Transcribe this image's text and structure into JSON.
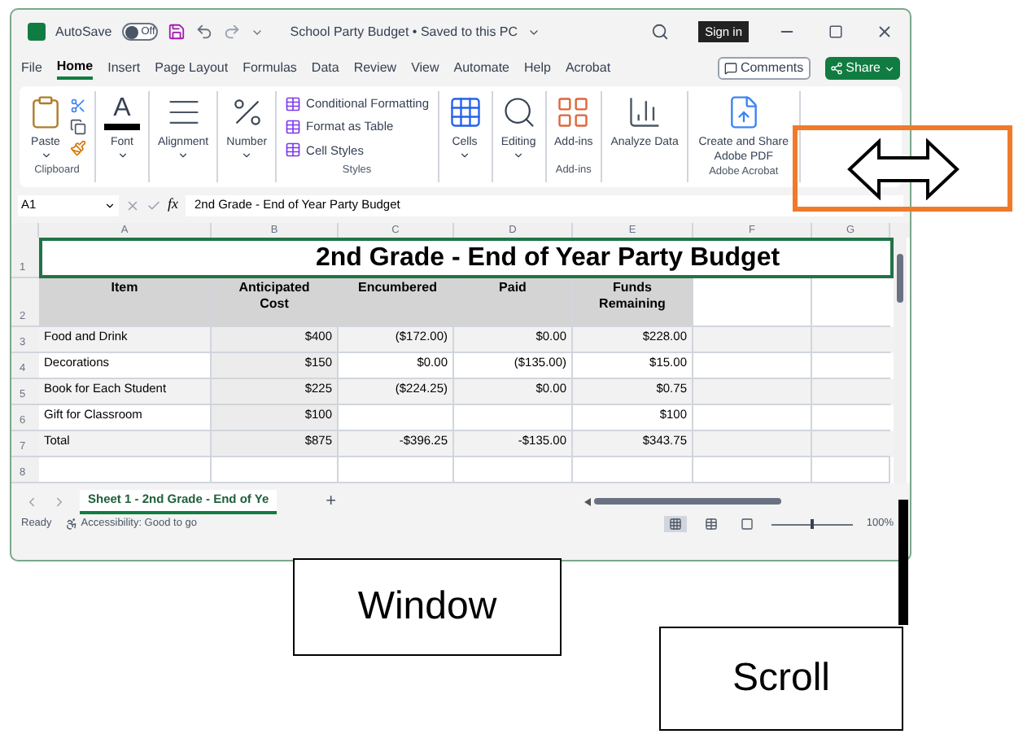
{
  "window": {
    "autosave": {
      "label": "AutoSave",
      "toggle": "Off",
      "on": false
    },
    "title": "School Party Budget • Saved to this PC",
    "sign_in": "Sign in"
  },
  "menu_tabs": [
    {
      "label": "File",
      "selected": false
    },
    {
      "label": "Home",
      "selected": true
    },
    {
      "label": "Insert",
      "selected": false
    },
    {
      "label": "Page Layout",
      "selected": false
    },
    {
      "label": "Formulas",
      "selected": false
    },
    {
      "label": "Data",
      "selected": false
    },
    {
      "label": "Review",
      "selected": false
    },
    {
      "label": "View",
      "selected": false
    },
    {
      "label": "Automate",
      "selected": false
    },
    {
      "label": "Help",
      "selected": false
    },
    {
      "label": "Acrobat",
      "selected": false
    }
  ],
  "comments": "Comments",
  "share": "Share",
  "ribbon": [
    {
      "label": "Clipboard",
      "buttons": [
        {
          "kind": "paste",
          "label": "Paste"
        }
      ]
    },
    {
      "buttons": [
        {
          "kind": "font",
          "label": "Font",
          "glyph": "A"
        }
      ]
    },
    {
      "buttons": [
        {
          "kind": "align",
          "label": "Alignment"
        }
      ]
    },
    {
      "buttons": [
        {
          "kind": "number",
          "label": "Number"
        }
      ]
    },
    {
      "label": "Styles",
      "buttons": [
        {
          "kind": "style",
          "label": "Conditional Formatting"
        },
        {
          "kind": "style",
          "label": "Format as Table"
        },
        {
          "kind": "style",
          "label": "Cell Styles"
        }
      ]
    },
    {
      "buttons": [
        {
          "kind": "cells",
          "label": "Cells"
        }
      ]
    },
    {
      "buttons": [
        {
          "kind": "editing",
          "label": "Editing"
        }
      ]
    },
    {
      "label": "Add-ins",
      "buttons": [
        {
          "kind": "addins",
          "label": "Add-ins"
        }
      ]
    },
    {
      "buttons": [
        {
          "kind": "analyze",
          "label": "Analyze Data"
        }
      ]
    },
    {
      "label": "Adobe Acrobat",
      "buttons": [
        {
          "kind": "pdf",
          "label": "Create and Share Adobe PDF"
        }
      ]
    }
  ],
  "formula_bar": {
    "name_box": "A1",
    "fx": "fx",
    "formula": "2nd Grade - End of Year Party Budget"
  },
  "columns": [
    "A",
    "B",
    "C",
    "D",
    "E",
    "F",
    "G"
  ],
  "row_numbers": [
    "1",
    "2",
    "3",
    "4",
    "5",
    "6",
    "7",
    "8"
  ],
  "sheet": {
    "title": "2nd Grade - End of Year Party Budget",
    "headers": [
      "Item",
      "Anticipated Cost",
      "Encumbered",
      "Paid",
      "Funds Remaining"
    ],
    "rows": [
      [
        "Food  and Drink",
        "$400",
        "($172.00)",
        "$0.00",
        "$228.00"
      ],
      [
        "Decorations",
        "$150",
        "$0.00",
        "($135.00)",
        "$15.00"
      ],
      [
        "Book for Each Student",
        "$225",
        "($224.25)",
        "$0.00",
        "$0.75"
      ],
      [
        "Gift for Classroom",
        "$100",
        "",
        "",
        "$100"
      ],
      [
        "Total",
        "$875",
        "-$396.25",
        "-$135.00",
        "$343.75"
      ]
    ]
  },
  "sheet_tabs": [
    {
      "label": "Sheet 1 - 2nd Grade - End of Ye",
      "selected": true
    }
  ],
  "add_sheet": "+",
  "status_bar": {
    "ready": "Ready",
    "accessibility": "Accessibility: Good to go",
    "views": [
      {
        "kind": "normal",
        "selected": true
      },
      {
        "kind": "layout",
        "selected": false
      },
      {
        "kind": "break",
        "selected": false
      }
    ],
    "zoom": {
      "level": 0.5
    },
    "zoom_text": "100%"
  },
  "annotations": [
    {
      "kind": "arrow-box"
    },
    {
      "kind": "label",
      "text": "Window"
    },
    {
      "kind": "bar"
    },
    {
      "kind": "label",
      "text": "Scroll"
    }
  ]
}
